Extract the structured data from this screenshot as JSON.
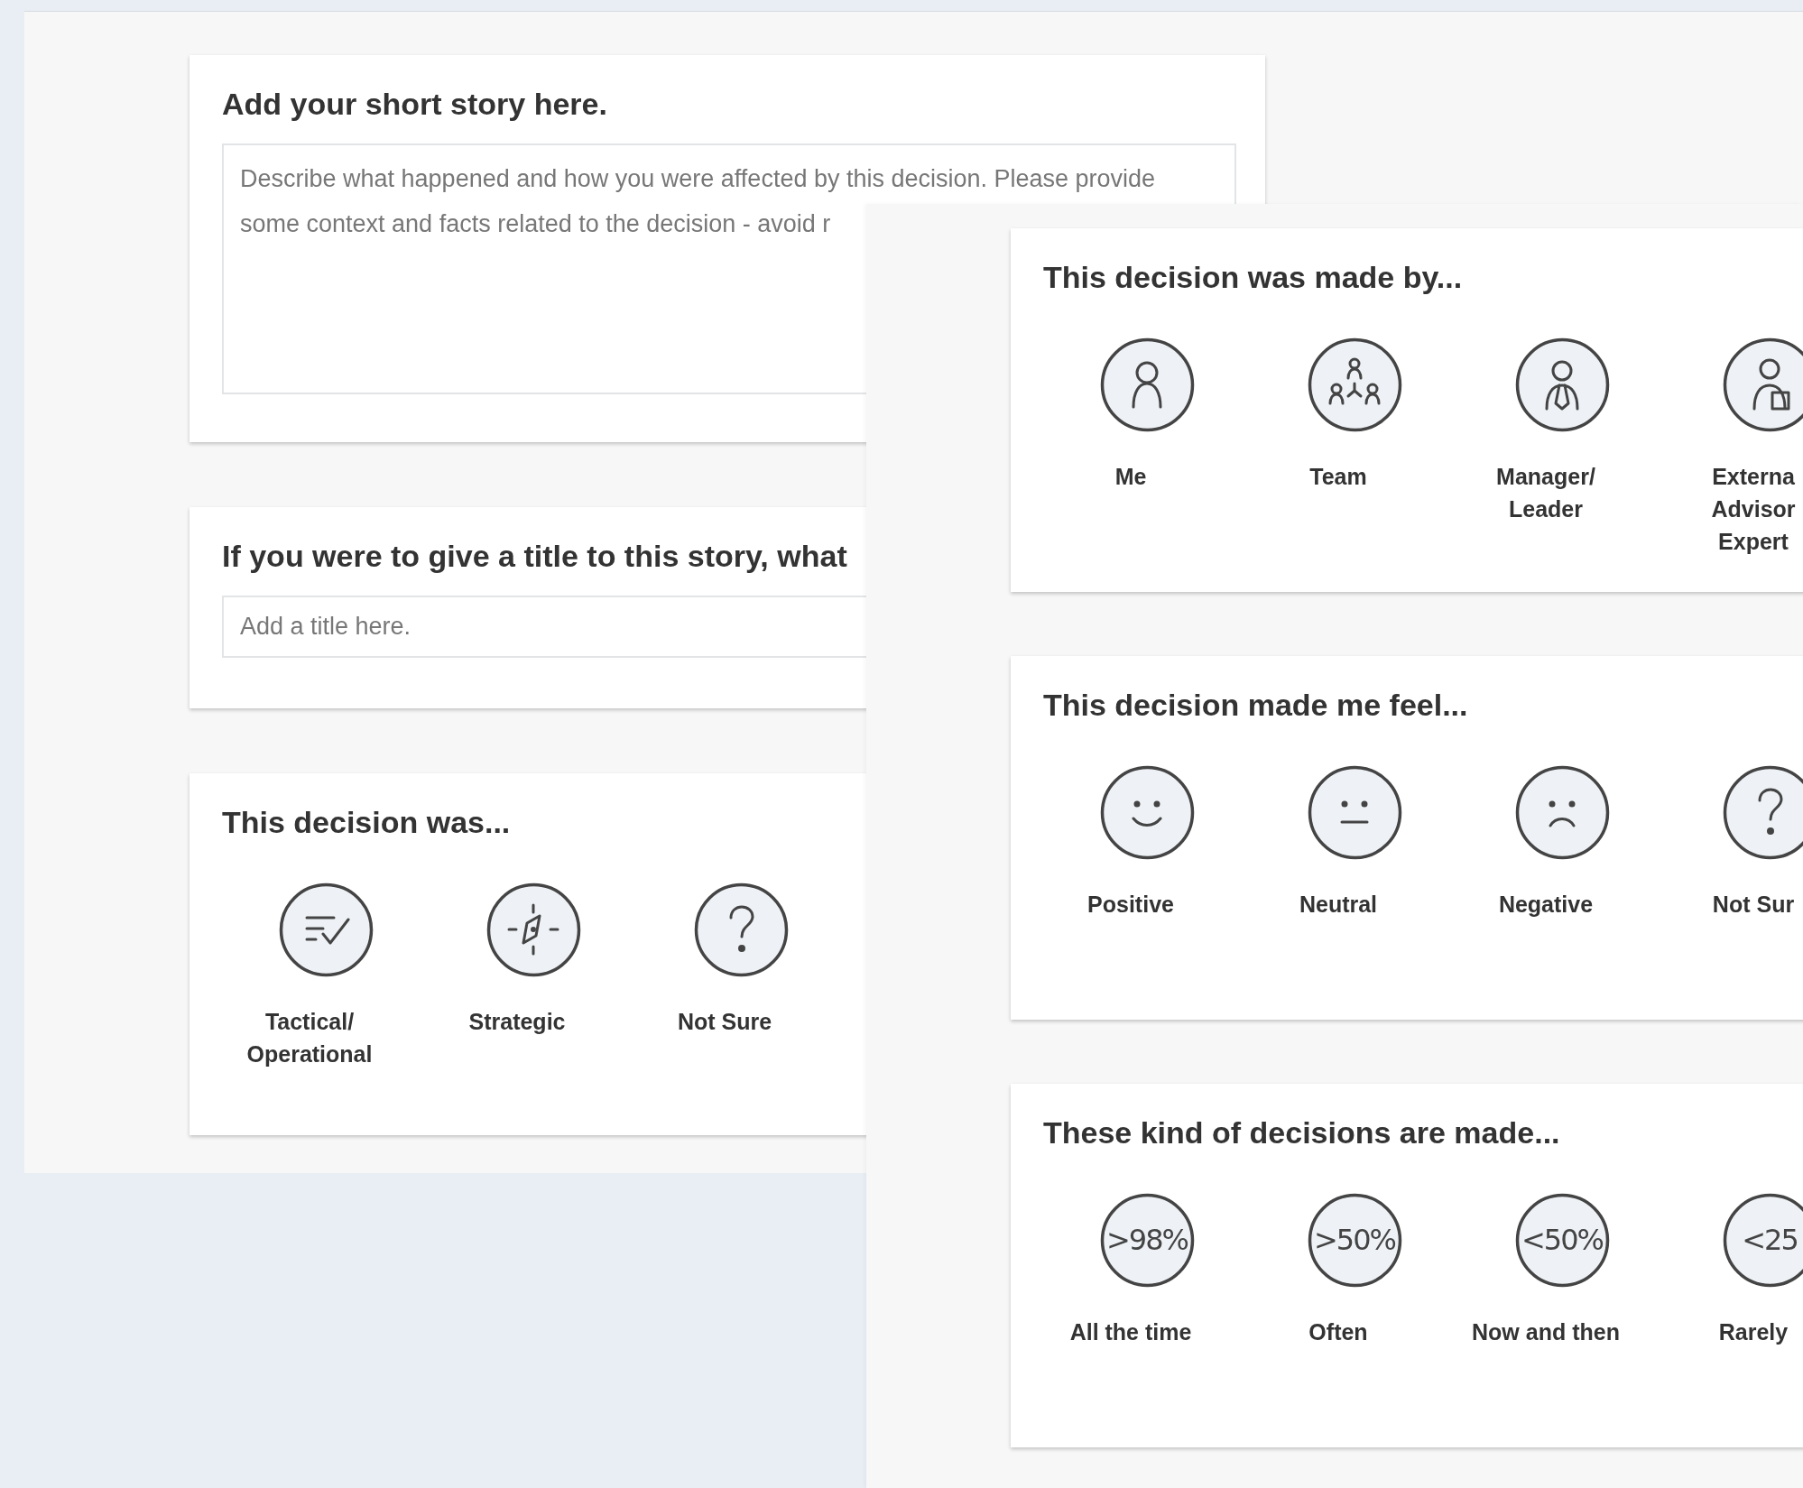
{
  "story_screen": {
    "story_card": {
      "title": "Add your short story here.",
      "placeholder_lines": [
        "Describe what happened and how you were affected by this decision. Please provide",
        "some context and facts related to the decision - avoid r"
      ]
    },
    "title_card": {
      "title": "If you were to give a title to this story, what",
      "placeholder": "Add a title here."
    },
    "type_card": {
      "title": "This decision was...",
      "options": [
        {
          "kind": "checklist",
          "label_lines": [
            "Tactical/",
            "Operational"
          ]
        },
        {
          "kind": "compass",
          "label_lines": [
            "Strategic"
          ]
        },
        {
          "kind": "question",
          "label_lines": [
            "Not Sure"
          ]
        }
      ]
    }
  },
  "decision_screen": {
    "cards": [
      {
        "title": "This decision was made by...",
        "options": [
          {
            "kind": "person",
            "label_lines": [
              "Me"
            ]
          },
          {
            "kind": "team",
            "label_lines": [
              "Team"
            ]
          },
          {
            "kind": "manager",
            "label_lines": [
              "Manager/",
              "Leader"
            ]
          },
          {
            "kind": "advisor",
            "label_lines": [
              "Externa",
              "Advisor",
              "Expert"
            ]
          }
        ]
      },
      {
        "title": "This decision made me feel...",
        "options": [
          {
            "kind": "smile",
            "label_lines": [
              "Positive"
            ]
          },
          {
            "kind": "neutral",
            "label_lines": [
              "Neutral"
            ]
          },
          {
            "kind": "sad",
            "label_lines": [
              "Negative"
            ]
          },
          {
            "kind": "question",
            "label_lines": [
              "Not Sur"
            ]
          }
        ]
      },
      {
        "title": "These kind of decisions are made...",
        "options": [
          {
            "kind": "percent",
            "badge": ">98%",
            "label_lines": [
              "All the time"
            ]
          },
          {
            "kind": "percent",
            "badge": ">50%",
            "label_lines": [
              "Often"
            ]
          },
          {
            "kind": "percent",
            "badge": "<50%",
            "label_lines": [
              "Now and then"
            ]
          },
          {
            "kind": "percent",
            "badge": "<25",
            "label_lines": [
              "Rarely"
            ]
          }
        ]
      }
    ]
  }
}
